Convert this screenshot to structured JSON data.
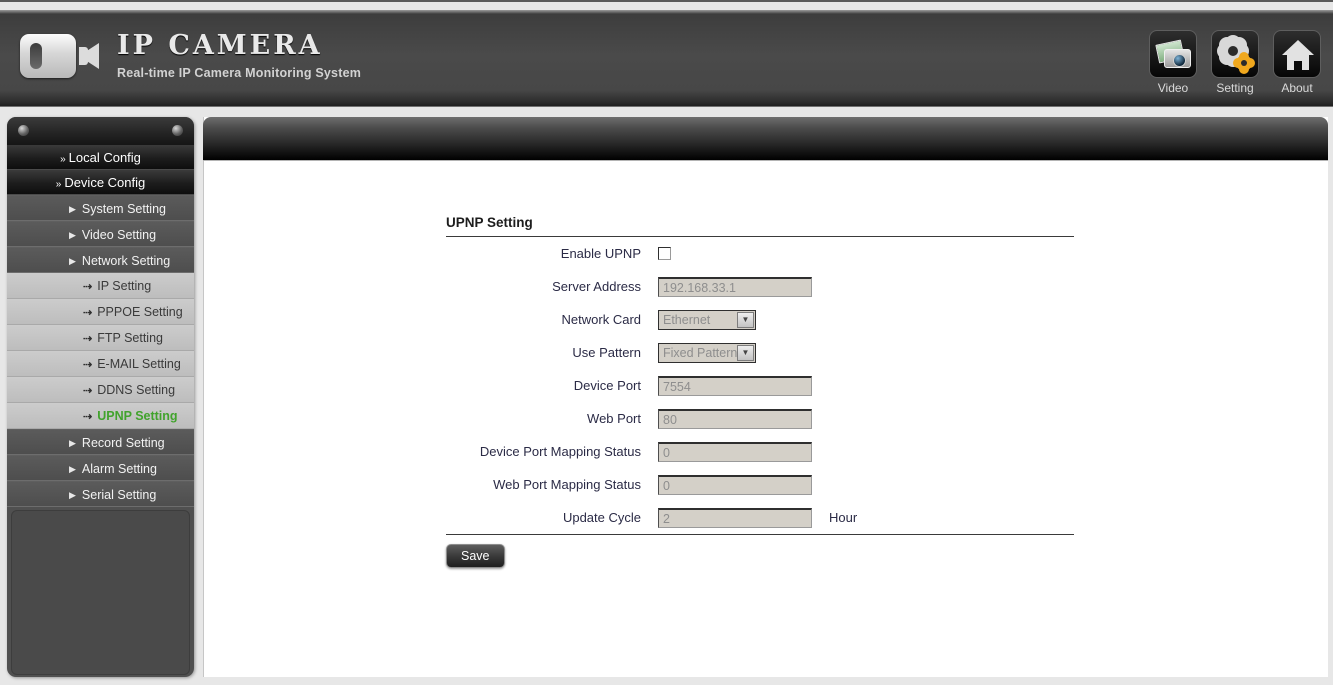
{
  "header": {
    "title": "IP CAMERA",
    "subtitle": "Real-time IP Camera Monitoring System",
    "logo_icon": "video-camera-icon",
    "nav": [
      {
        "label": "Video",
        "icon": "video-icon"
      },
      {
        "label": "Setting",
        "icon": "gear-icon"
      },
      {
        "label": "About",
        "icon": "house-icon"
      }
    ]
  },
  "sidebar": {
    "top_items": [
      {
        "label": "Local Config",
        "marker": "»"
      },
      {
        "label": "Device Config",
        "marker": "»"
      }
    ],
    "items": [
      {
        "label": "System Setting",
        "type": "parent",
        "marker": "▶"
      },
      {
        "label": "Video Setting",
        "type": "parent",
        "marker": "▶"
      },
      {
        "label": "Network Setting",
        "type": "parent",
        "marker": "▶"
      },
      {
        "label": "IP Setting",
        "type": "child",
        "marker": "⇢",
        "active": false
      },
      {
        "label": "PPPOE Setting",
        "type": "child",
        "marker": "⇢",
        "active": false
      },
      {
        "label": "FTP Setting",
        "type": "child",
        "marker": "⇢",
        "active": false
      },
      {
        "label": "E-MAIL Setting",
        "type": "child",
        "marker": "⇢",
        "active": false
      },
      {
        "label": "DDNS Setting",
        "type": "child",
        "marker": "⇢",
        "active": false
      },
      {
        "label": "UPNP Setting",
        "type": "child",
        "marker": "⇢",
        "active": true
      },
      {
        "label": "Record Setting",
        "type": "parent",
        "marker": "▶"
      },
      {
        "label": "Alarm Setting",
        "type": "parent",
        "marker": "▶"
      },
      {
        "label": "Serial Setting",
        "type": "parent",
        "marker": "▶"
      }
    ],
    "active_color": "#41a32c"
  },
  "main": {
    "panel_title": "UPNP Setting",
    "fields": [
      {
        "label": "Enable UPNP",
        "kind": "checkbox",
        "checked": false
      },
      {
        "label": "Server Address",
        "kind": "text",
        "value": "192.168.33.1",
        "disabled": true
      },
      {
        "label": "Network Card",
        "kind": "select",
        "value": "Ethernet",
        "disabled": true
      },
      {
        "label": "Use Pattern",
        "kind": "select",
        "value": "Fixed Pattern",
        "disabled": true
      },
      {
        "label": "Device Port",
        "kind": "text",
        "value": "7554",
        "disabled": true
      },
      {
        "label": "Web Port",
        "kind": "text",
        "value": "80",
        "disabled": true
      },
      {
        "label": "Device Port Mapping Status",
        "kind": "text",
        "value": "0",
        "disabled": true
      },
      {
        "label": "Web Port Mapping Status",
        "kind": "text",
        "value": "0",
        "disabled": true
      },
      {
        "label": "Update Cycle",
        "kind": "text",
        "value": "2",
        "disabled": true,
        "suffix": "Hour"
      }
    ],
    "save_label": "Save"
  }
}
